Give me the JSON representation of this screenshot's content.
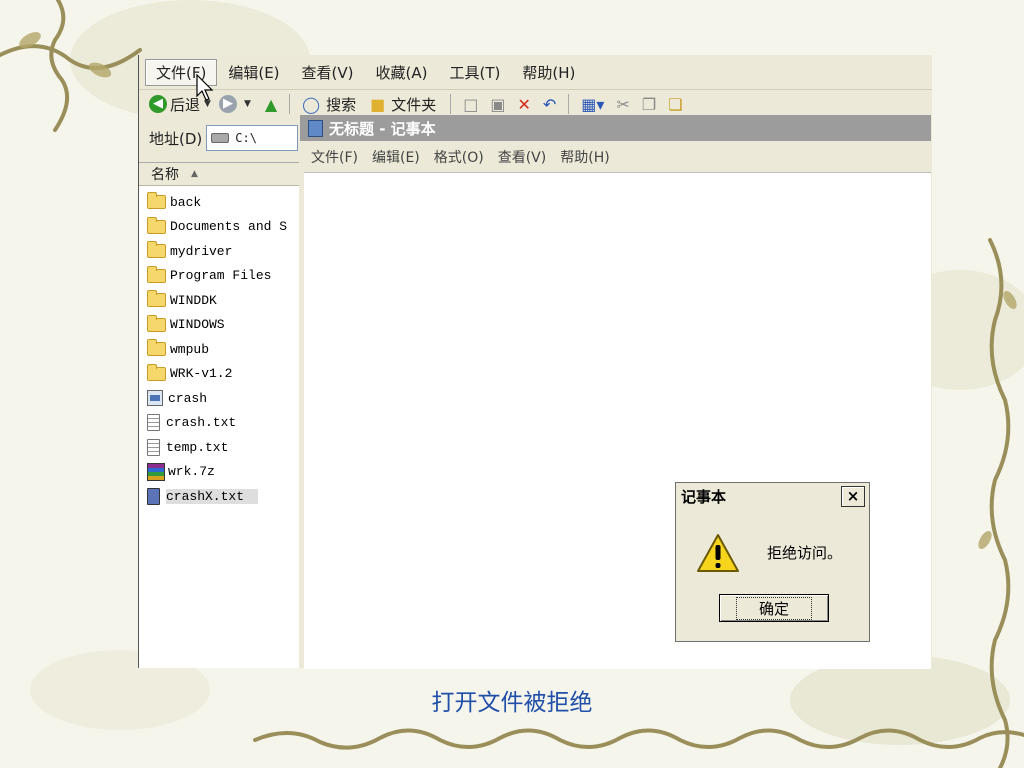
{
  "explorer": {
    "menu": [
      "文件(F)",
      "编辑(E)",
      "查看(V)",
      "收藏(A)",
      "工具(T)",
      "帮助(H)"
    ],
    "toolbar": {
      "back_label": "后退",
      "search_label": "搜索",
      "folders_label": "文件夹"
    },
    "address": {
      "label": "地址(D)",
      "value": "C:\\"
    },
    "column_header": "名称",
    "files": [
      {
        "name": "back",
        "icon": "folder-icon"
      },
      {
        "name": "Documents and S",
        "icon": "folder-icon"
      },
      {
        "name": "mydriver",
        "icon": "folder-icon"
      },
      {
        "name": "Program Files",
        "icon": "folder-icon"
      },
      {
        "name": "WINDDK",
        "icon": "folder-icon"
      },
      {
        "name": "WINDOWS",
        "icon": "folder-icon"
      },
      {
        "name": "wmpub",
        "icon": "folder-icon"
      },
      {
        "name": "WRK-v1.2",
        "icon": "folder-icon"
      },
      {
        "name": "crash",
        "icon": "exe-icon"
      },
      {
        "name": "crash.txt",
        "icon": "text-file-icon"
      },
      {
        "name": "temp.txt",
        "icon": "text-file-icon"
      },
      {
        "name": "wrk.7z",
        "icon": "archive-icon"
      },
      {
        "name": "crashX.txt",
        "icon": "text-file-icon",
        "selected": true
      }
    ]
  },
  "notepad": {
    "title": "无标题 - 记事本",
    "menu": [
      "文件(F)",
      "编辑(E)",
      "格式(O)",
      "查看(V)",
      "帮助(H)"
    ]
  },
  "dialog": {
    "title": "记事本",
    "close_label": "×",
    "message": "拒绝访问。",
    "ok_label": "确定",
    "icon": "warning-icon"
  },
  "caption": "打开文件被拒绝",
  "colors": {
    "caption": "#1f4fa8",
    "window_face": "#ece9d8",
    "folder": "#f6d76b"
  }
}
